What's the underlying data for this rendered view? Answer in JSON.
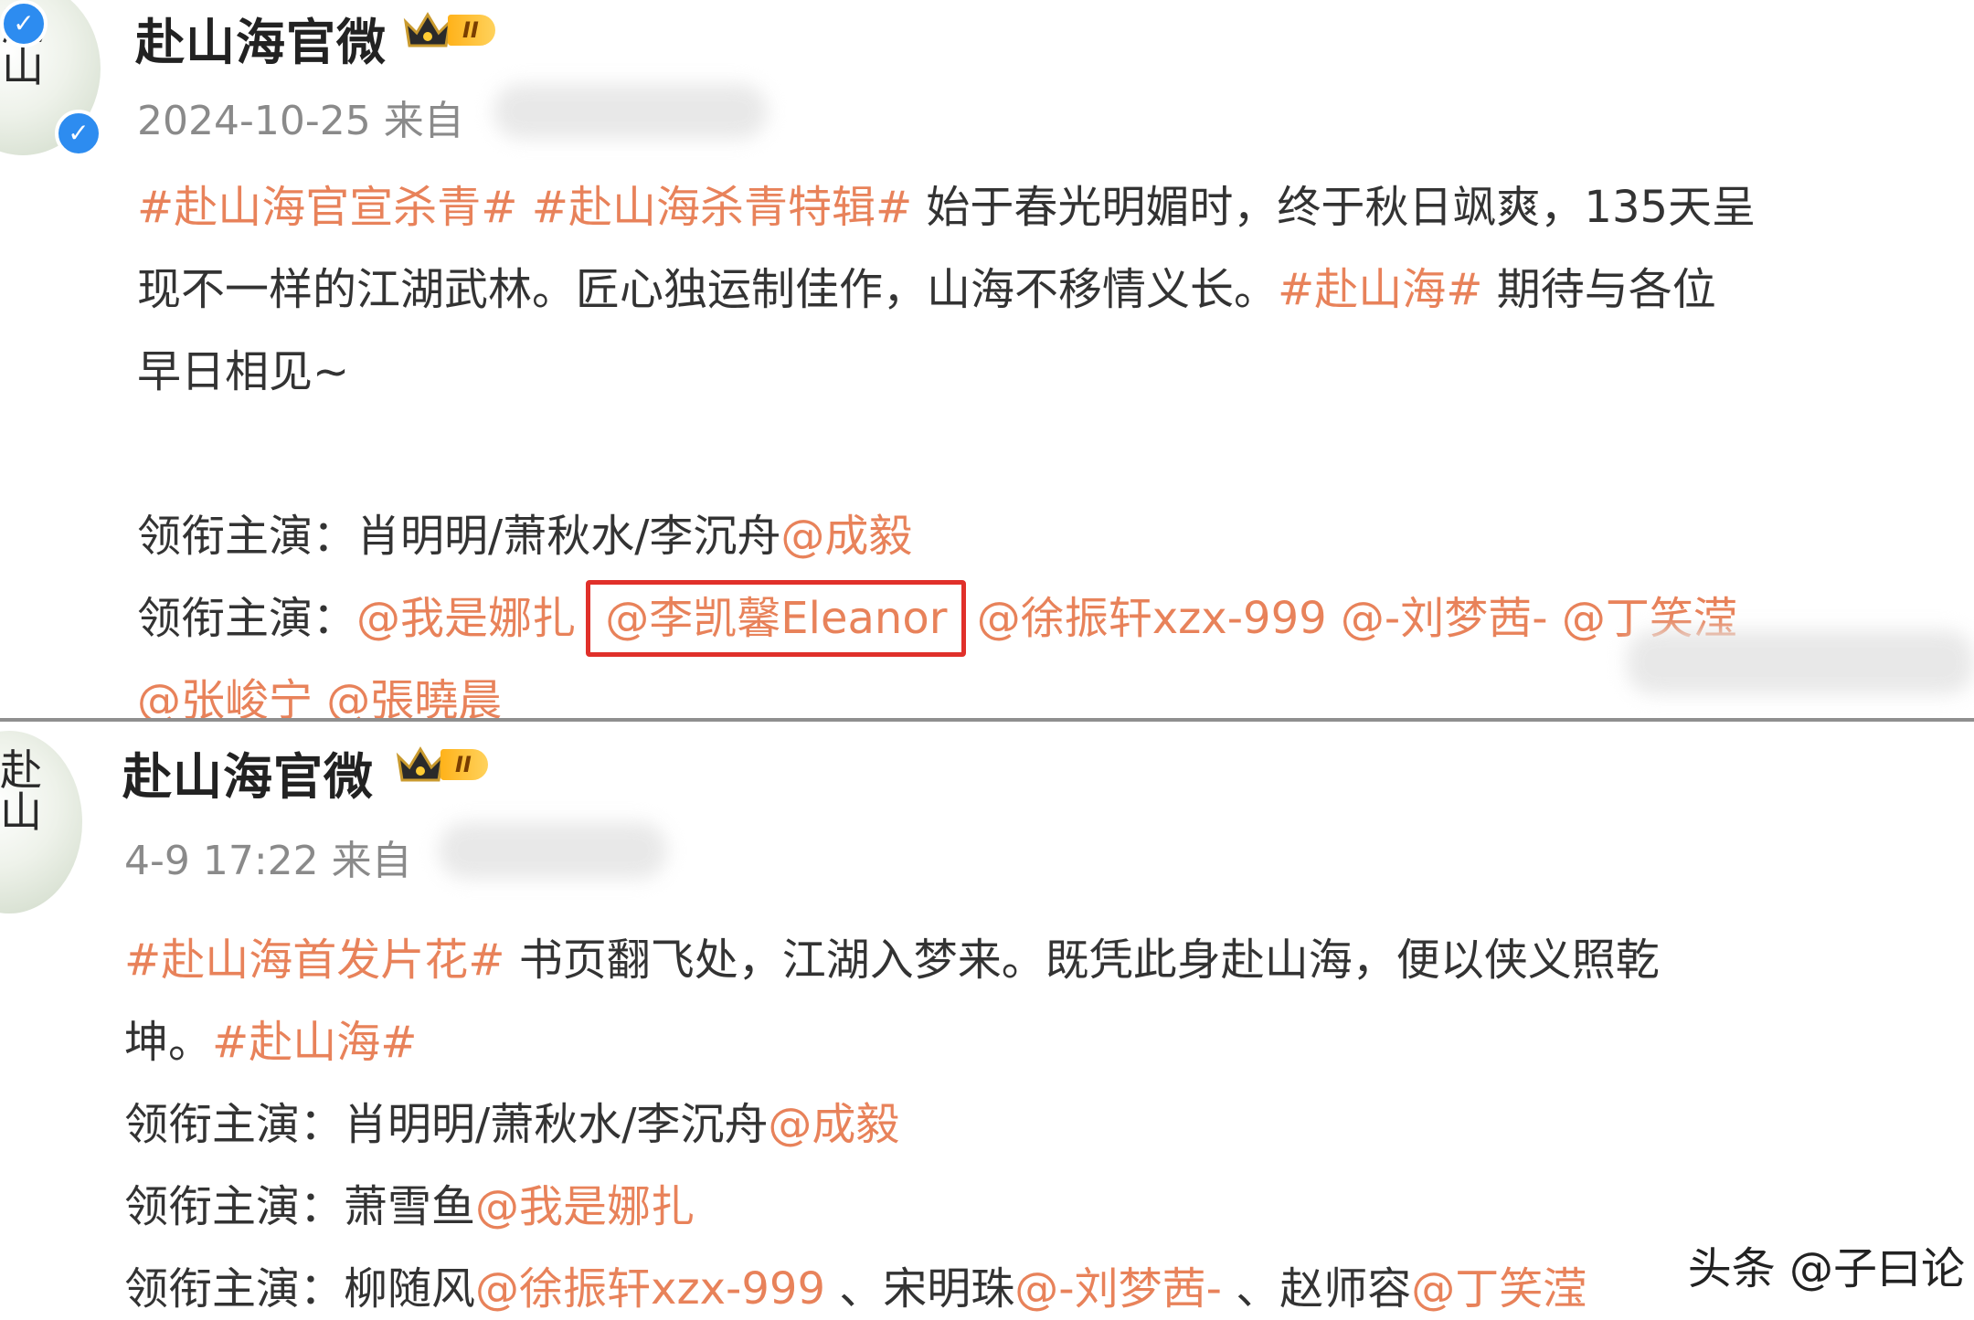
{
  "posts": [
    {
      "account_name": "赴山海官微",
      "vip_level": "II",
      "date": "2024-10-25",
      "source_label": "来自",
      "lines": {
        "l1": [
          {
            "t": "#赴山海官宣杀青#",
            "hl": true
          },
          {
            "t": " ",
            "hl": false
          },
          {
            "t": "#赴山海杀青特辑#",
            "hl": true
          },
          {
            "t": " 始于春光明媚时，终于秋日飒爽，135天呈",
            "hl": false
          }
        ],
        "l2": [
          {
            "t": "现不一样的江湖武林。匠心独运制佳作，山海不移情义长。",
            "hl": false
          },
          {
            "t": "#赴山海#",
            "hl": true
          },
          {
            "t": " 期待与各位",
            "hl": false
          }
        ],
        "l3": "早日相见~",
        "l4_label": "领衔主演：",
        "l4_roles": "肖明明/萧秋水/李沉舟",
        "l4_mention": "@成毅",
        "l5_label": "领衔主演：",
        "l5_mention_a": "@我是娜扎",
        "l5_mention_boxed": "@李凯馨Eleanor",
        "l5_mention_b": "@徐振轩xzx-999",
        "l5_mention_c": "@-刘梦茜-",
        "l5_mention_d": "@丁笑滢",
        "l6_mention_a": "@张峻宁",
        "l6_mention_b": "@張曉晨"
      }
    },
    {
      "account_name": "赴山海官微",
      "vip_level": "II",
      "date": "4-9 17:22",
      "source_label": "来自",
      "lines": {
        "l1_tag": "#赴山海首发片花#",
        "l1_text": " 书页翻飞处，江湖入梦来。既凭此身赴山海，便以侠义照乾",
        "l2_text": "坤。",
        "l2_tag": "#赴山海#",
        "l3_label": "领衔主演：",
        "l3_roles": "肖明明/萧秋水/李沉舟",
        "l3_mention": "@成毅",
        "l4_label": "领衔主演：",
        "l4_roles": "萧雪鱼",
        "l4_mention": "@我是娜扎",
        "l5_label": "领衔主演：",
        "l5_role_a": "柳随风",
        "l5_mention_a": "@徐振轩xzx-999",
        "l5_sep": "、",
        "l5_role_b": "宋明珠",
        "l5_mention_b": "@-刘梦茜-",
        "l5_role_c": "赵师容",
        "l5_mention_c": "@丁笑滢"
      }
    }
  ],
  "watermark": "头条 @子曰论",
  "icons": {
    "crown": "crown-icon",
    "verified": "verified-check-icon"
  },
  "colors": {
    "highlight": "#e8825a",
    "box": "#e0302a",
    "verified": "#2d8cf0"
  }
}
